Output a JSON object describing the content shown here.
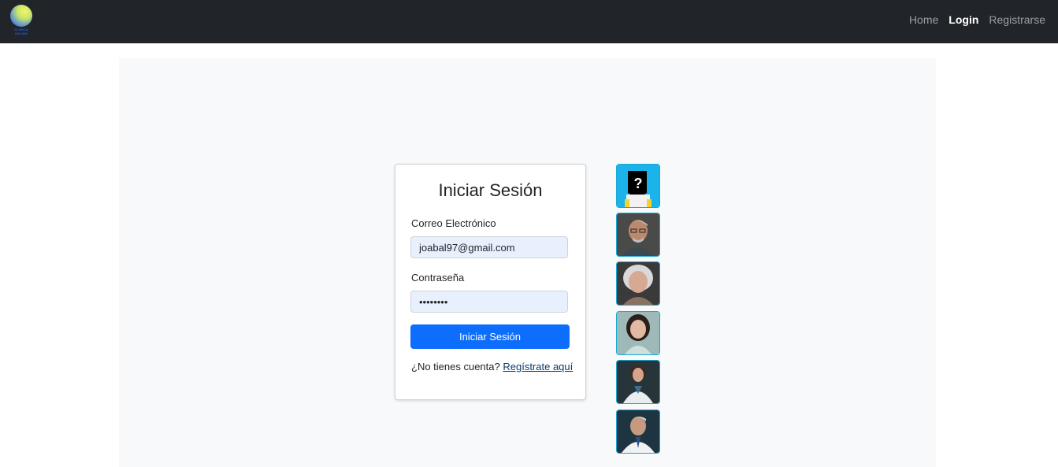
{
  "navbar": {
    "logo_text": [
      "CLINICA",
      "ONLINE"
    ],
    "links": [
      {
        "label": "Home",
        "active": false
      },
      {
        "label": "Login",
        "active": true
      },
      {
        "label": "Registrarse",
        "active": false
      }
    ]
  },
  "login": {
    "title": "Iniciar Sesión",
    "email_label": "Correo Electrónico",
    "email_value": "joabal97@gmail.com",
    "password_label": "Contraseña",
    "password_value": "12345678",
    "submit_label": "Iniciar Sesión",
    "register_prompt": "¿No tienes cuenta?",
    "register_link": "Regístrate aquí"
  },
  "quick_users": [
    {
      "icon": "unknown-user-icon"
    },
    {
      "icon": "elderly-man-avatar"
    },
    {
      "icon": "elderly-woman-avatar"
    },
    {
      "icon": "young-woman-avatar"
    },
    {
      "icon": "female-doctor-avatar"
    },
    {
      "icon": "male-doctor-avatar"
    }
  ],
  "colors": {
    "navbar_bg": "#212529",
    "primary": "#0d6efd",
    "avatar_border": "#1aa7d6"
  }
}
